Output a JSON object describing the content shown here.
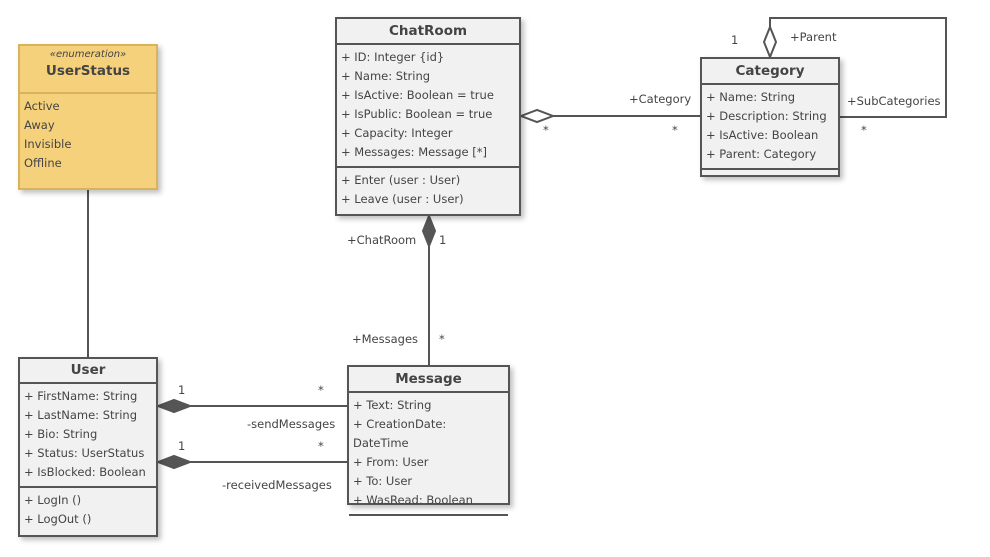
{
  "classes": {
    "userstatus": {
      "stereotype": "«enumeration»",
      "name": "UserStatus",
      "literals": [
        "Active",
        "Away",
        "Invisible",
        "Offline"
      ]
    },
    "user": {
      "name": "User",
      "attributes": [
        "+ FirstName: String",
        "+ LastName: String",
        "+ Bio: String",
        "+ Status: UserStatus",
        "+ IsBlocked: Boolean"
      ],
      "operations": [
        "+ LogIn ()",
        "+ LogOut ()"
      ]
    },
    "chatroom": {
      "name": "ChatRoom",
      "attributes": [
        "+ ID: Integer {id}",
        "+ Name: String",
        "+ IsActive: Boolean = true",
        "+ IsPublic: Boolean = true",
        "+ Capacity: Integer",
        "+ Messages: Message [*]"
      ],
      "operations": [
        "+ Enter (user : User)",
        "+ Leave (user : User)"
      ]
    },
    "category": {
      "name": "Category",
      "attributes": [
        "+ Name: String",
        "+ Description: String",
        "+ IsActive: Boolean",
        "+ Parent: Category"
      ],
      "operations": []
    },
    "message": {
      "name": "Message",
      "attributes": [
        "+ Text: String",
        "+ CreationDate: DateTime",
        "+ From: User",
        "+ To: User",
        "+ WasRead: Boolean"
      ],
      "operations": []
    }
  },
  "labels": {
    "parent_mult": "1",
    "parent_role": "+Parent",
    "sub_role": "+SubCategories",
    "sub_mult": "*",
    "category_role": "+Category",
    "chatroom_agg_mult": "*",
    "category_mult": "*",
    "chatroom_role": "+ChatRoom",
    "chatroom_mult": "1",
    "messages_role": "+Messages",
    "messages_mult": "*",
    "send_user_mult": "1",
    "send_msg_mult": "*",
    "send_role": "-sendMessages",
    "recv_user_mult": "1",
    "recv_msg_mult": "*",
    "recv_role": "-receivedMessages"
  },
  "colors": {
    "enum_fill": "#f6d17c",
    "class_fill": "#f1f1f1",
    "line": "#555555"
  }
}
